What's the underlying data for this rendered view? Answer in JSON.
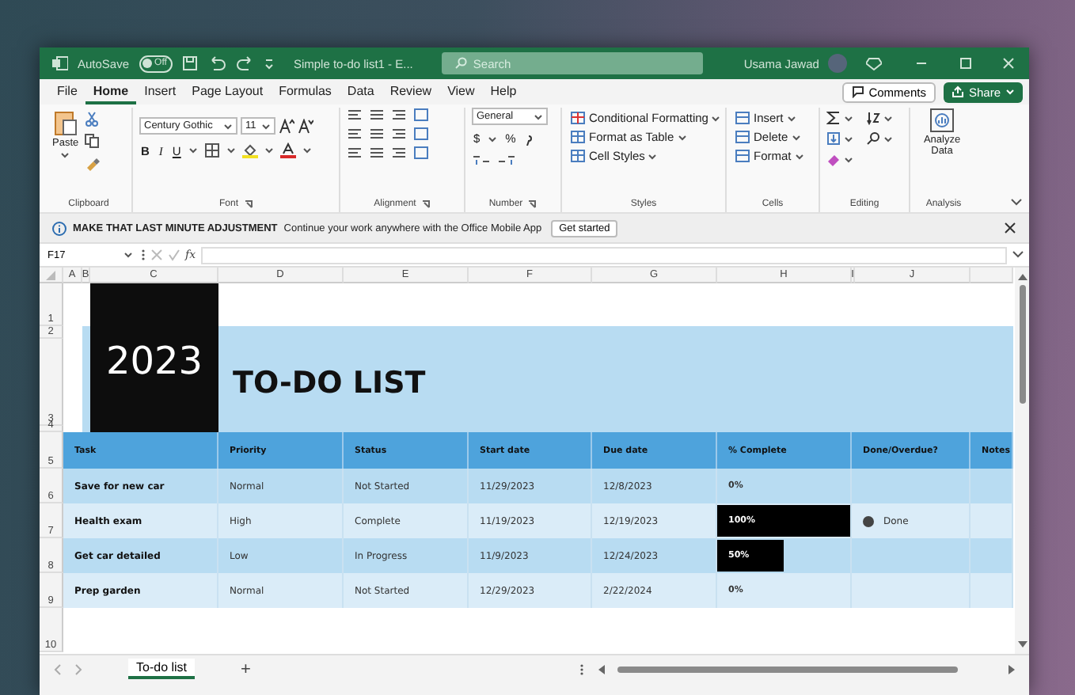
{
  "title_bar": {
    "autosave_label": "AutoSave",
    "autosave": {
      "on": false,
      "label": "Off"
    },
    "document_title": "Simple to-do list1 - E...",
    "search_placeholder": "Search",
    "user_name": "Usama Jawad"
  },
  "menu": [
    {
      "label": "File",
      "selected": false
    },
    {
      "label": "Home",
      "selected": true
    },
    {
      "label": "Insert",
      "selected": false
    },
    {
      "label": "Page Layout",
      "selected": false
    },
    {
      "label": "Formulas",
      "selected": false
    },
    {
      "label": "Data",
      "selected": false
    },
    {
      "label": "Review",
      "selected": false
    },
    {
      "label": "View",
      "selected": false
    },
    {
      "label": "Help",
      "selected": false
    }
  ],
  "comments_button": "Comments",
  "share_button": "Share",
  "ribbon": {
    "clipboard": {
      "label": "Clipboard",
      "paste": "Paste"
    },
    "font": {
      "label": "Font",
      "family": "Century Gothic",
      "size": "11",
      "bold": "B",
      "italic": "I",
      "underline": "U"
    },
    "alignment": {
      "label": "Alignment"
    },
    "number": {
      "label": "Number",
      "format": "General",
      "currency": "$",
      "percent": "%"
    },
    "styles": {
      "label": "Styles",
      "items": [
        "Conditional Formatting",
        "Format as Table",
        "Cell Styles"
      ]
    },
    "cells": {
      "label": "Cells",
      "items": [
        "Insert",
        "Delete",
        "Format"
      ]
    },
    "editing": {
      "label": "Editing"
    },
    "analysis": {
      "label": "Analysis",
      "button": "Analyze Data"
    }
  },
  "info_bar": {
    "title": "MAKE THAT LAST MINUTE ADJUSTMENT",
    "message": "Continue your work anywhere with the Office Mobile App",
    "button": "Get started"
  },
  "formula_bar": {
    "name_box": "F17",
    "function_label": "fx"
  },
  "columns": [
    "A",
    "B",
    "C",
    "D",
    "E",
    "F",
    "G",
    "H",
    "I",
    "J"
  ],
  "row_numbers": [
    "1",
    "2",
    "3",
    "4",
    "5",
    "6",
    "7",
    "8",
    "9",
    "10"
  ],
  "sheet": {
    "year": "2023",
    "title": "TO-DO LIST",
    "headers": [
      "Task",
      "Priority",
      "Status",
      "Start date",
      "Due date",
      "% Complete",
      "Done/Overdue?",
      "Notes"
    ],
    "rows": [
      {
        "task": "Save for new car",
        "priority": "Normal",
        "status": "Not Started",
        "start": "11/29/2023",
        "due": "12/8/2023",
        "complete": "0%",
        "level": 0
      },
      {
        "task": "Health exam",
        "priority": "High",
        "status": "Complete",
        "start": "11/19/2023",
        "due": "12/19/2023",
        "complete": "100%",
        "level": 1,
        "done_label": "Done"
      },
      {
        "task": "Get car detailed",
        "priority": "Low",
        "status": "In Progress",
        "start": "11/9/2023",
        "due": "12/24/2023",
        "complete": "50%",
        "level": 0.5
      },
      {
        "task": "Prep garden",
        "priority": "Normal",
        "status": "Not Started",
        "start": "12/29/2023",
        "due": "2/22/2024",
        "complete": "0%",
        "level": 0
      }
    ]
  },
  "sheet_tabs": [
    {
      "label": "To-do list",
      "selected": true
    }
  ],
  "add_sheet": "+"
}
